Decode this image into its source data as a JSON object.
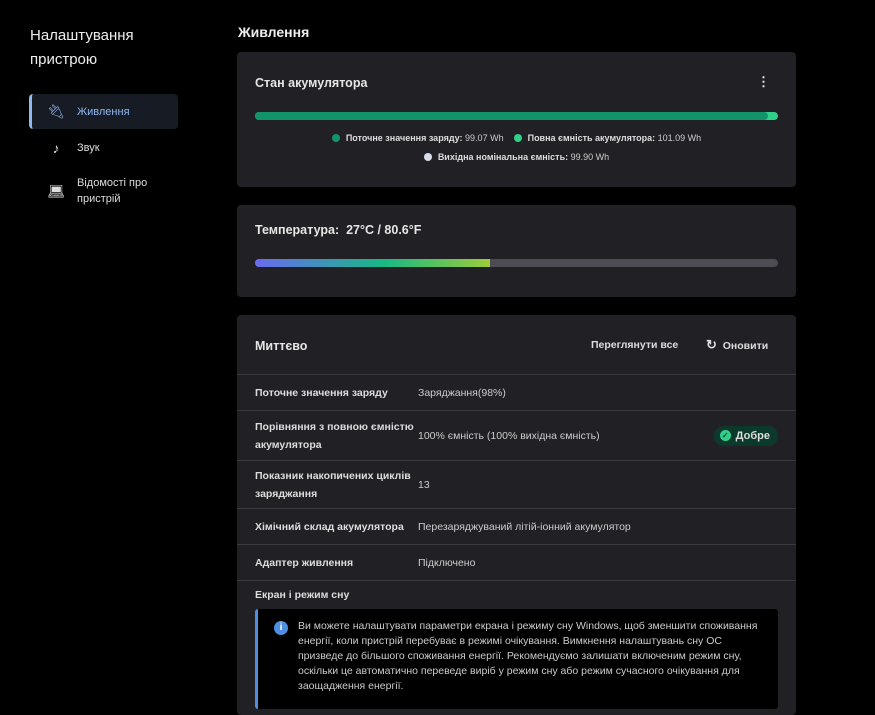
{
  "sidebar": {
    "title": "Налаштування пристрою",
    "items": [
      {
        "label": "Живлення",
        "icon": "plug-icon",
        "active": true
      },
      {
        "label": "Звук",
        "icon": "music-note-icon"
      },
      {
        "label": "Відомості про пристрій",
        "icon": "laptop-icon"
      }
    ]
  },
  "page_title": "Живлення",
  "battery": {
    "title": "Стан акумулятора",
    "charge_fraction": 0.98,
    "legend": [
      {
        "label": "Поточне значення заряду:",
        "value": "99.07 Wh",
        "color": "#12936a"
      },
      {
        "label": "Повна ємність акумулятора:",
        "value": "101.09 Wh",
        "color": "#2fd08a"
      },
      {
        "label": "Вихідна номінальна ємність:",
        "value": "99.90 Wh",
        "color": "#d8dce8"
      }
    ]
  },
  "temperature": {
    "label": "Температура:",
    "value": "27°C / 80.6°F",
    "fill_fraction": 0.45
  },
  "instant": {
    "title": "Миттєво",
    "view_all": "Переглянути все",
    "refresh": "Оновити",
    "rows": [
      {
        "key": "Поточне значення заряду",
        "value": "Заряджання(98%)"
      },
      {
        "key": "Порівняння з повною ємністю акумулятора",
        "value": "100% ємність (100% вихідна ємність)",
        "badge": "Добре"
      },
      {
        "key": "Показник накопичених циклів заряджання",
        "value": "13"
      },
      {
        "key": "Хімічний склад акумулятора",
        "value": "Перезаряджуваний літій-іонний акумулятор"
      },
      {
        "key": "Адаптер живлення",
        "value": "Підключено"
      }
    ],
    "sleep_title": "Екран і режим сну",
    "sleep_info": "Ви можете налаштувати параметри екрана і режиму сну Windows, щоб зменшити споживання енергії, коли пристрій перебуває в режимі очікування. Вимкнення налаштувань сну ОС призведе до більшого споживання енергії. Рекомендуємо залишати включеним режим сну, оскільки це автоматично переведе виріб у режим сну або режим сучасного очікування для заощадження енергії."
  }
}
